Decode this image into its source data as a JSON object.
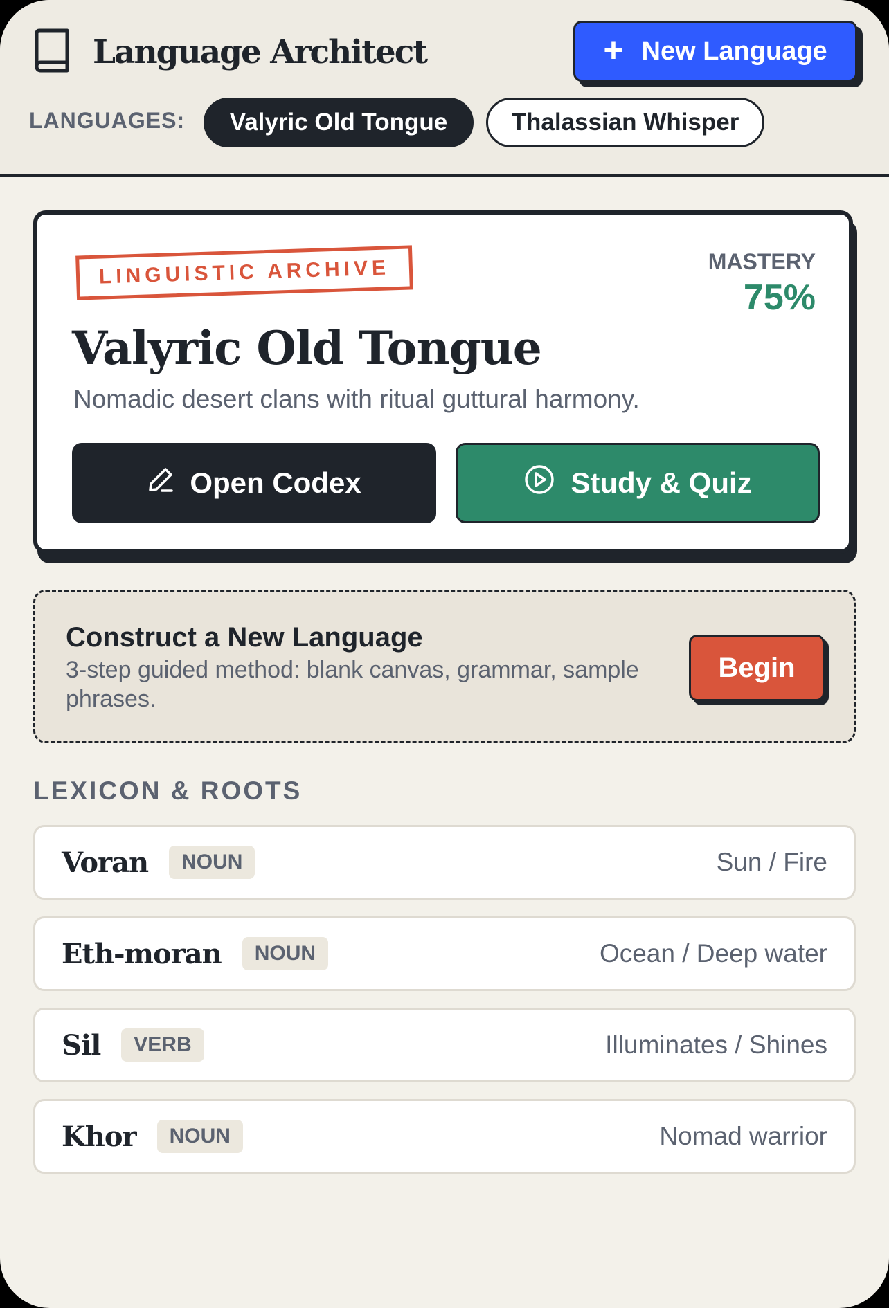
{
  "header": {
    "title": "Language Architect",
    "new_language_label": "New Language",
    "languages_label": "LANGUAGES:",
    "languages": [
      {
        "name": "Valyric Old Tongue",
        "active": true
      },
      {
        "name": "Thalassian Whisper",
        "active": false
      }
    ]
  },
  "archive": {
    "stamp": "LINGUISTIC ARCHIVE",
    "mastery_label": "MASTERY",
    "mastery_value": "75%",
    "title": "Valyric Old Tongue",
    "description": "Nomadic desert clans with ritual guttural harmony.",
    "open_codex_label": "Open Codex",
    "study_quiz_label": "Study & Quiz"
  },
  "construct": {
    "title": "Construct a New Language",
    "description": "3-step guided method: blank canvas, grammar, sample phrases.",
    "begin_label": "Begin"
  },
  "lexicon": {
    "heading": "LEXICON & ROOTS",
    "entries": [
      {
        "word": "Voran",
        "pos": "NOUN",
        "meaning": "Sun / Fire"
      },
      {
        "word": "Eth-moran",
        "pos": "NOUN",
        "meaning": "Ocean / Deep water"
      },
      {
        "word": "Sil",
        "pos": "VERB",
        "meaning": "Illuminates / Shines"
      },
      {
        "word": "Khor",
        "pos": "NOUN",
        "meaning": "Nomad warrior"
      }
    ]
  },
  "colors": {
    "ink": "#1f242b",
    "primary_blue": "#2f5bff",
    "accent_green": "#2d8a6a",
    "accent_red": "#d9553b",
    "muted_text": "#5b6270",
    "background": "#f3f1ea"
  },
  "icons": {
    "brand": "book-icon",
    "new_language": "plus-icon",
    "open_codex": "pencil-icon",
    "study_quiz": "play-circle-icon"
  }
}
